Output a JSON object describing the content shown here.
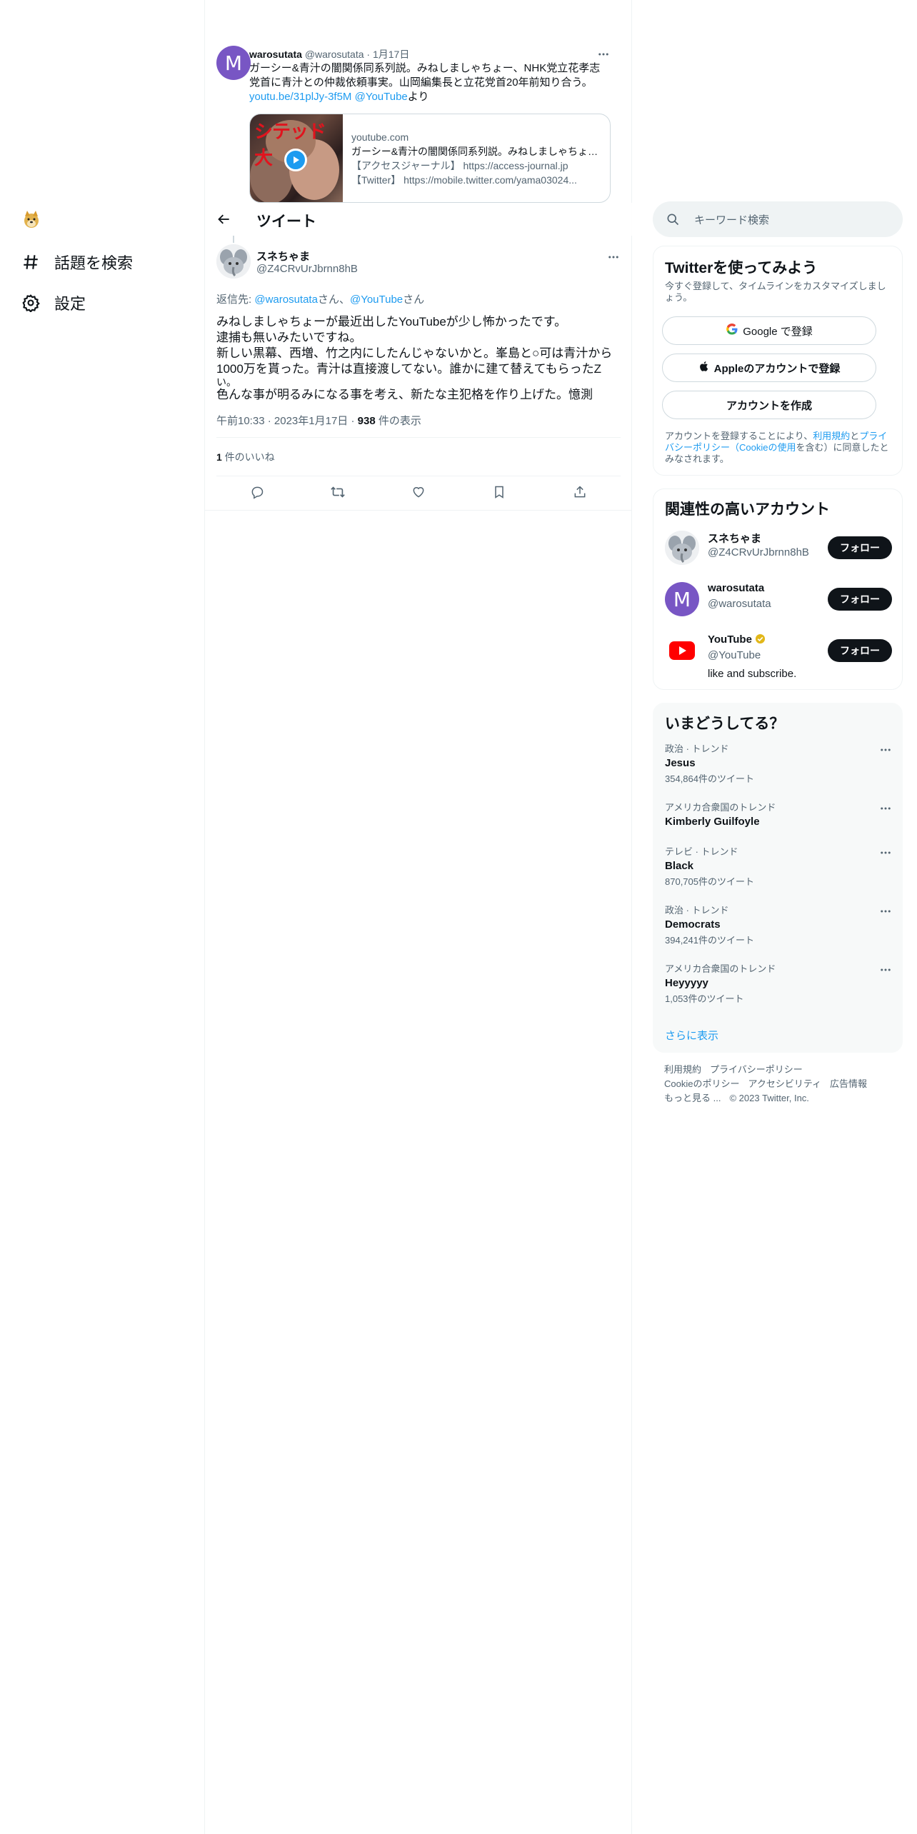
{
  "nav": {
    "items": [
      {
        "label": "話題を検索",
        "icon": "hashtag-icon"
      },
      {
        "label": "設定",
        "icon": "gear-icon"
      }
    ]
  },
  "previous_tweet": {
    "name": "warosutata",
    "handle": "@warosutata",
    "sep": "·",
    "date": "1月17日",
    "avatar_letter": "M",
    "text_line1": "ガーシー&青汁の闇関係同系列説。みねしましゃちょー、NHK党立花孝志",
    "text_line2": "党首に青汁との仲裁依頼事実。山岡編集長と立花党首20年前知り合う。",
    "link1": "youtu.be/31plJy-3f5M",
    "link2": "@YouTube",
    "link_suffix": "より",
    "card": {
      "domain": "youtube.com",
      "title": "ガーシー&青汁の闇関係同系列説。みねしましゃちょー、NHK党立花孝志",
      "desc1": "【アクセスジャーナル】 https://access-journal.jp",
      "desc2": "【Twitter】 https://mobile.twitter.com/yama03024...",
      "thumb_label": "シテッド大"
    }
  },
  "header": {
    "title": "ツイート"
  },
  "main_tweet": {
    "name": "スネちゃま",
    "handle": "@Z4CRvUrJbrnn8hB",
    "reply_prefix": "返信先: ",
    "reply_user1": "@warosutata",
    "reply_mid": "さん、",
    "reply_user2": "@YouTube",
    "reply_suffix": "さん",
    "lines": [
      "みねしましゃちょーが最近出したYouTubeが少し怖かったです。",
      "逮捕も無いみたいですね。",
      "新しい黒幕、西増、竹之内にしたんじゃないかと。峯島と○可は青汁から",
      "1000万を貰った。青汁は直接渡してない。誰かに建て替えてもらったZ",
      "い。",
      "色んな事が明るみになる事を考え、新たな主犯格を作り上げた。憶測"
    ],
    "time": "午前10:33",
    "sep": "·",
    "date": "2023年1月17日",
    "views_count": "938",
    "views_label": " 件の表示",
    "likes_count": "1",
    "likes_label": " 件のいいね"
  },
  "search": {
    "placeholder": "キーワード検索"
  },
  "signup": {
    "title": "Twitterを使ってみよう",
    "sub": "今すぐ登録して、タイムラインをカスタマイズしましょう。",
    "google_label": "Google で登録",
    "apple_label": "Appleのアカウントで登録",
    "create_label": "アカウントを作成",
    "legal_prefix": "アカウントを登録することにより、",
    "legal_terms": "利用規約",
    "legal_and": "と",
    "legal_privacy": "プライバシーポリシー（Cookieの使用",
    "legal_suffix": "を含む）に同意したとみなされます。"
  },
  "related": {
    "title": "関連性の高いアカウント",
    "accounts": [
      {
        "name": "スネちゃま",
        "handle": "@Z4CRvUrJbrnn8hB",
        "bio": "",
        "button": "フォロー"
      },
      {
        "name": "warosutata",
        "handle": "@warosutata",
        "bio": "",
        "button": "フォロー",
        "avatar_letter": "M"
      },
      {
        "name": "YouTube",
        "handle": "@YouTube",
        "bio": "like and subscribe.",
        "button": "フォロー"
      }
    ]
  },
  "trends": {
    "title": "いまどうしてる？",
    "items": [
      {
        "category": "政治 · トレンド",
        "name": "Jesus",
        "count": "354,864件のツイート"
      },
      {
        "category": "アメリカ合衆国のトレンド",
        "name": "Kimberly Guilfoyle",
        "count": ""
      },
      {
        "category": "テレビ · トレンド",
        "name": "Black",
        "count": "870,705件のツイート"
      },
      {
        "category": "政治 · トレンド",
        "name": "Democrats",
        "count": "394,241件のツイート"
      },
      {
        "category": "アメリカ合衆国のトレンド",
        "name": "Heyyyyy",
        "count": "1,053件のツイート"
      }
    ],
    "show_more": "さらに表示"
  },
  "footer": {
    "terms": "利用規約",
    "privacy": "プライバシーポリシー",
    "cookie": "Cookieのポリシー",
    "accessibility": "アクセシビリティ",
    "ads": "広告情報",
    "more": "もっと見る ...",
    "copyright": "© 2023 Twitter, Inc."
  },
  "colors": {
    "accent": "#1d9bf0",
    "text": "#0f1419",
    "muted": "#536471",
    "avatar_purple": "#7856c4",
    "youtube_red": "#ff0000"
  }
}
